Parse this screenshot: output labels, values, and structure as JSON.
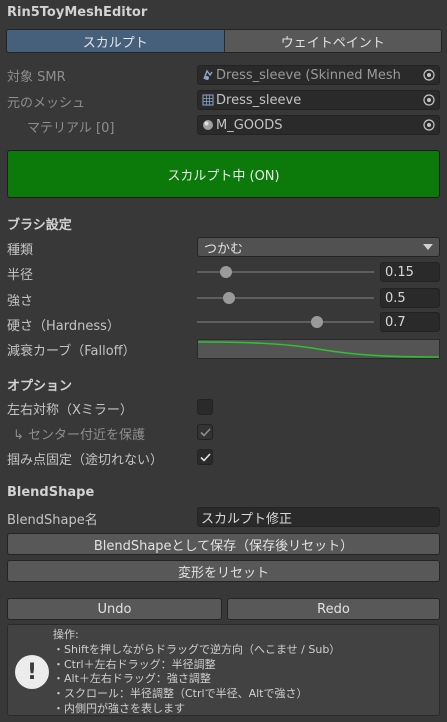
{
  "window": {
    "title": "Rin5ToyMeshEditor"
  },
  "tabs": [
    {
      "label": "スカルプト",
      "active": true
    },
    {
      "label": "ウェイトペイント",
      "active": false
    }
  ],
  "fields": {
    "target_smr": {
      "label": "対象 SMR",
      "value": "Dress_sleeve (Skinned Mesh",
      "icon": "skinned-mesh-icon"
    },
    "source_mesh": {
      "label": "元のメッシュ",
      "value": "Dress_sleeve",
      "icon": "mesh-grid-icon"
    },
    "material": {
      "label": "マテリアル [0]",
      "value": "M_GOODS",
      "icon": "material-sphere-icon"
    }
  },
  "sculpt_toggle": {
    "label": "スカルプト中 (ON)",
    "color": "#0b7a0b"
  },
  "brush": {
    "header": "ブラシ設定",
    "type": {
      "label": "種類",
      "value": "つかむ"
    },
    "radius": {
      "label": "半径",
      "value": "0.15",
      "fraction": 0.17
    },
    "strength": {
      "label": "強さ",
      "value": "0.5",
      "fraction": 0.19
    },
    "hardness": {
      "label": "硬さ（Hardness）",
      "value": "0.7",
      "fraction": 0.68
    },
    "falloff": {
      "label": "減衰カーブ（Falloff）",
      "curve_color": "#2fc12f"
    }
  },
  "options": {
    "header": "オプション",
    "mirror": {
      "label": "左右対称（Xミラー）",
      "checked": false
    },
    "protect_center": {
      "label": "↳ センター付近を保護",
      "checked": true
    },
    "fix_grab": {
      "label": "掴み点固定（途切れない）",
      "checked": true
    }
  },
  "blendshape": {
    "header": "BlendShape",
    "name_label": "BlendShape名",
    "name_value": "スカルプト修正",
    "save_button": "BlendShapeとして保存（保存後リセット）",
    "reset_button": "変形をリセット"
  },
  "history": {
    "undo": "Undo",
    "redo": "Redo"
  },
  "help": {
    "lines": [
      "操作:",
      "・Shiftを押しながらドラッグで逆方向（へこませ / Sub）",
      "・Ctrl＋左右ドラッグ：半径調整",
      "・Alt＋左右ドラッグ：強さ調整",
      "・スクロール：半径調整（Ctrlで半径、Altで強さ）",
      "・内側円が強さを表します"
    ]
  }
}
